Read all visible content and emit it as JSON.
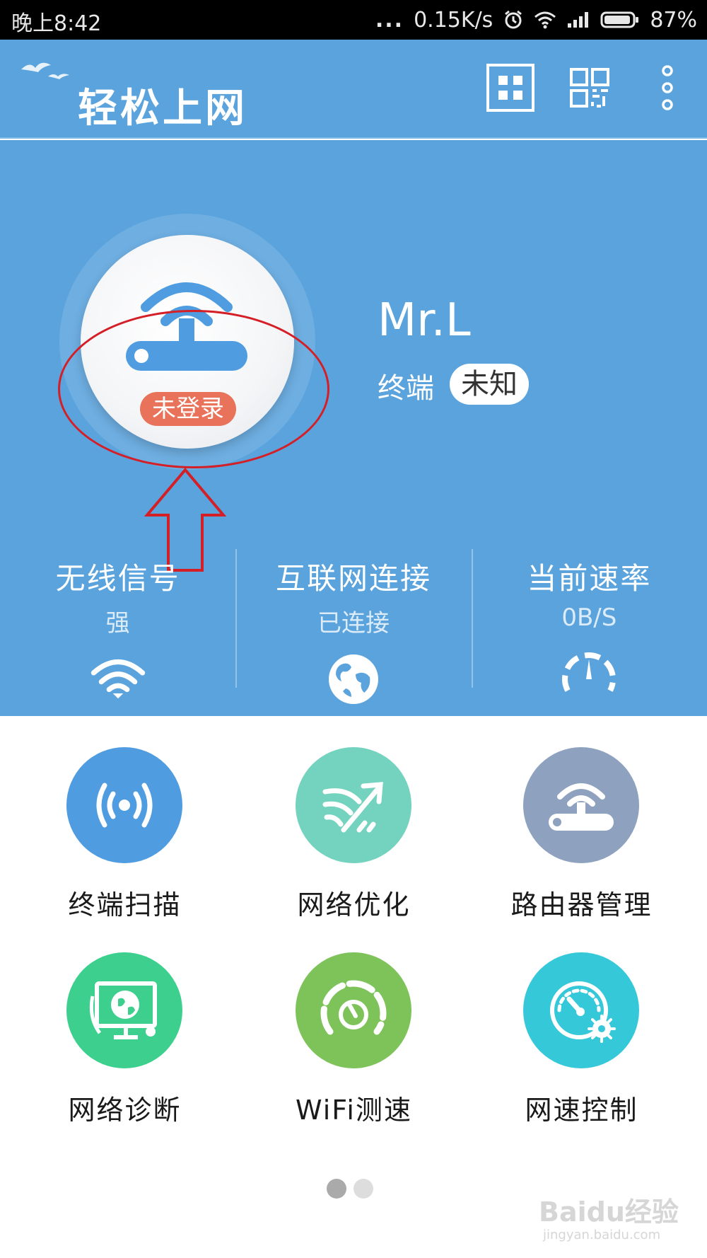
{
  "status_bar": {
    "time": "晚上8:42",
    "dots": "...",
    "speed": "0.15K/s",
    "battery": "87%"
  },
  "header": {
    "title": "轻松上网",
    "icons": [
      "grid-icon",
      "qr-code-icon",
      "more-vertical-icon"
    ]
  },
  "hero": {
    "login_badge": "未登录",
    "user_name": "Mr.L",
    "terminal_label": "终端",
    "terminal_value": "未知",
    "stats": [
      {
        "title": "无线信号",
        "value": "强",
        "icon": "wifi-icon"
      },
      {
        "title": "互联网连接",
        "value": "已连接",
        "icon": "globe-icon"
      },
      {
        "title": "当前速率",
        "value": "0B/S",
        "icon": "speedometer-icon"
      }
    ]
  },
  "features": [
    {
      "label": "终端扫描",
      "icon": "signal-scan-icon",
      "color": "#4f9de0"
    },
    {
      "label": "网络优化",
      "icon": "network-optimize-icon",
      "color": "#74d3be"
    },
    {
      "label": "路由器管理",
      "icon": "router-icon",
      "color": "#8ea2bf"
    },
    {
      "label": "网络诊断",
      "icon": "network-diagnose-icon",
      "color": "#3ccf8e"
    },
    {
      "label": "WiFi测速",
      "icon": "speed-test-icon",
      "color": "#7dc35a"
    },
    {
      "label": "网速控制",
      "icon": "speed-control-icon",
      "color": "#34c8d9"
    }
  ],
  "pager": {
    "pages": 2,
    "current": 1
  },
  "watermark": {
    "brand": "Baidu经验",
    "url": "jingyan.baidu.com"
  },
  "colors": {
    "primary": "#5aa3dd",
    "badge": "#e8735a",
    "annotation": "#d41f27"
  }
}
